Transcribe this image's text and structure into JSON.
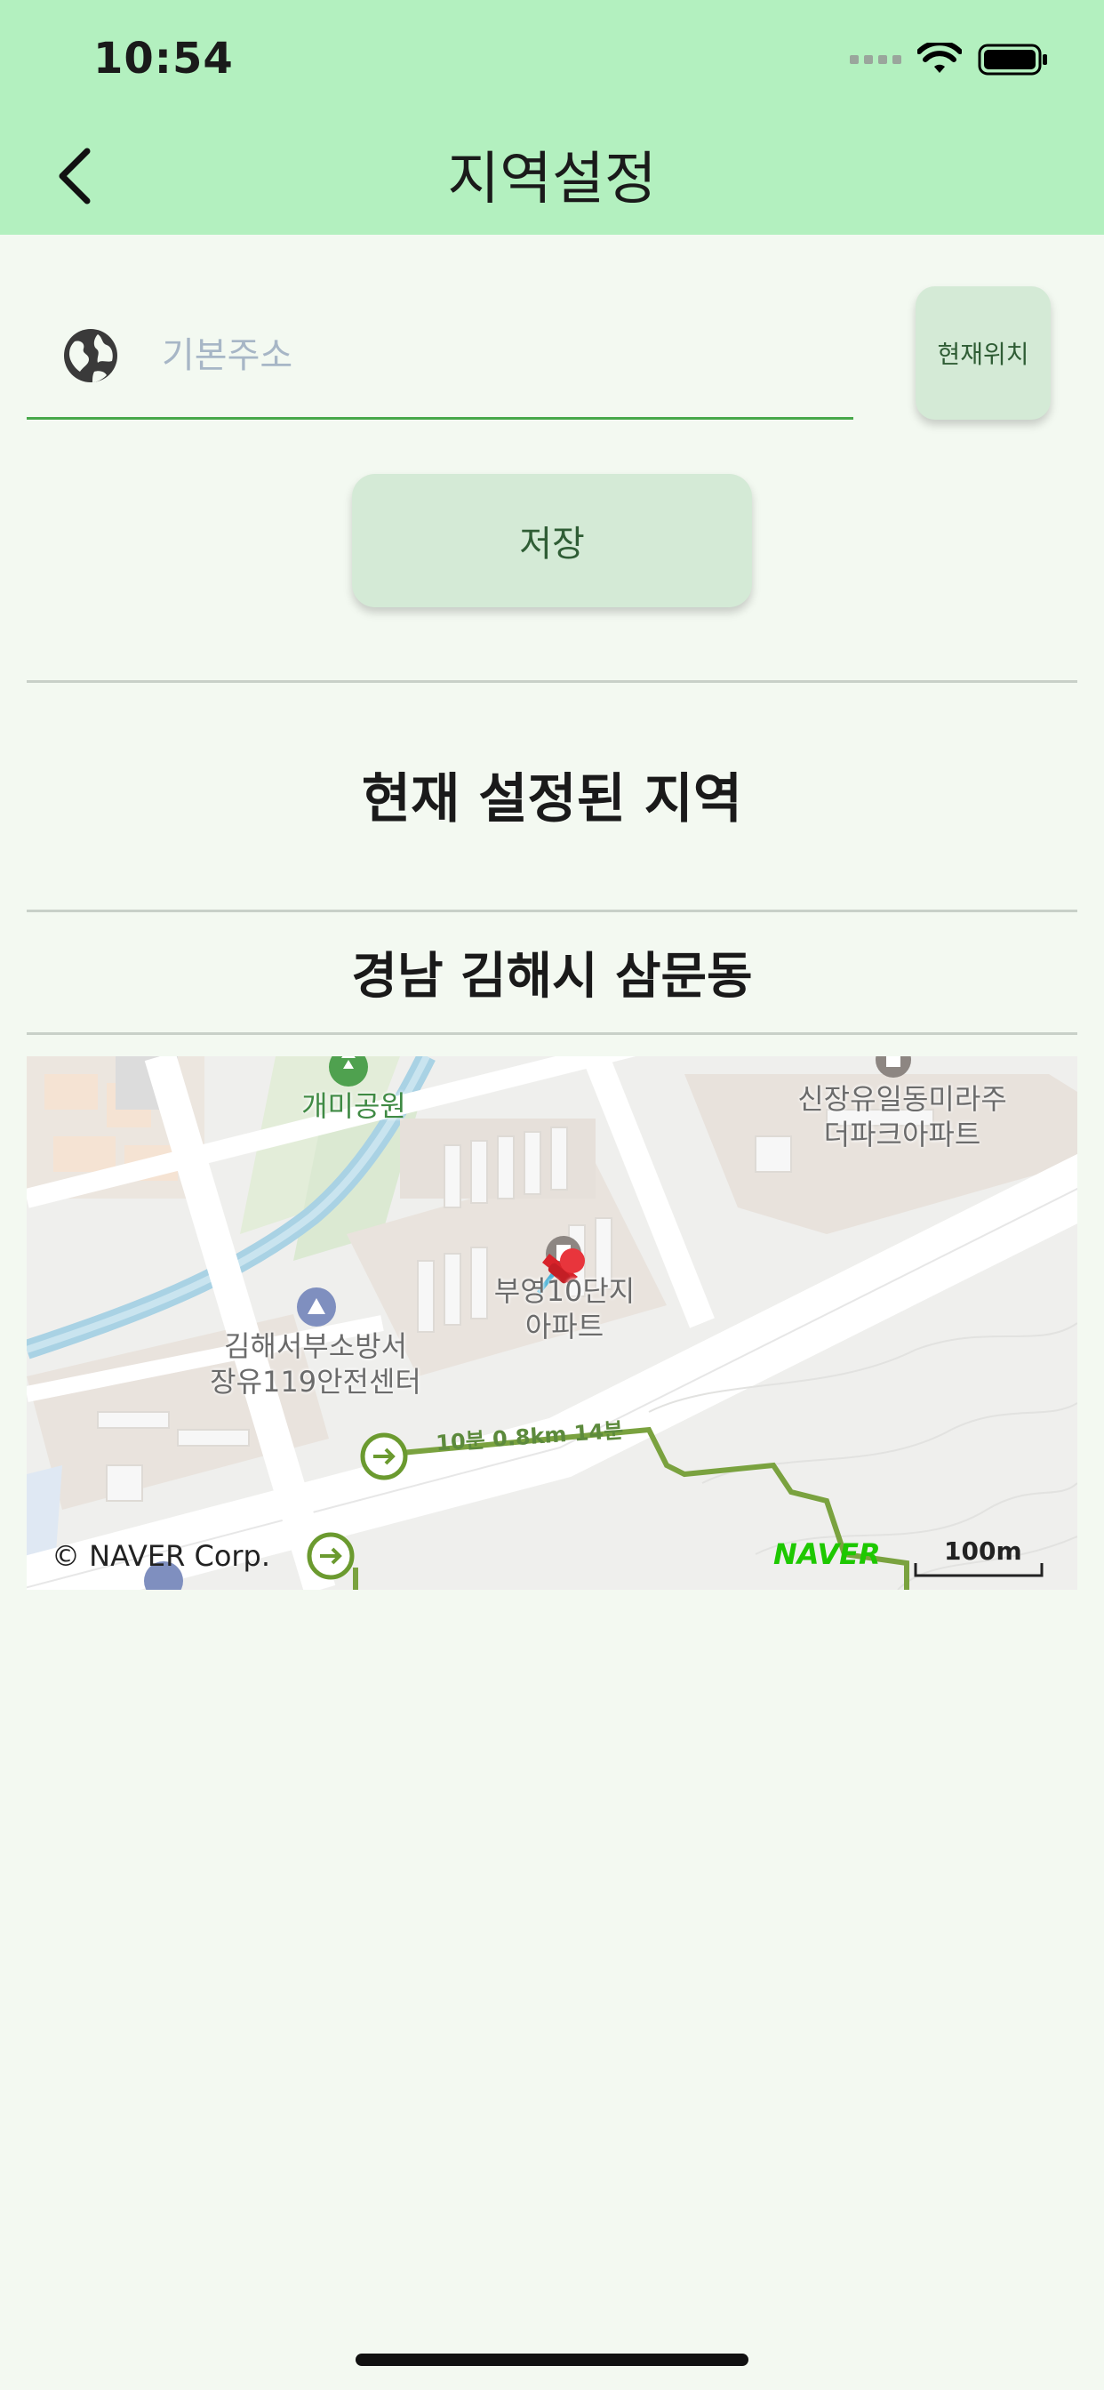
{
  "status_bar": {
    "time": "10:54"
  },
  "header": {
    "title": "지역설정"
  },
  "search": {
    "placeholder": "기본주소",
    "value": ""
  },
  "buttons": {
    "current_location": "현재위치",
    "save": "저장"
  },
  "section": {
    "heading": "현재 설정된 지역",
    "current_region": "경남 김해시 삼문동"
  },
  "map": {
    "labels": {
      "park": "개미공원",
      "apartment_ne": "신장유일동미라주\n더파크아파트",
      "apartment_pin": "부영10단지\n아파트",
      "fire_station": "김해서부소방서\n장유119안전센터",
      "route": "10분 0.8km 14분"
    },
    "copyright": "© NAVER Corp.",
    "logo": "NAVER",
    "scale": "100m"
  },
  "colors": {
    "header_bg": "#b3f0bf",
    "accent": "#47a84a",
    "button_bg": "#d4ead6",
    "page_bg": "#f3f9f1"
  }
}
